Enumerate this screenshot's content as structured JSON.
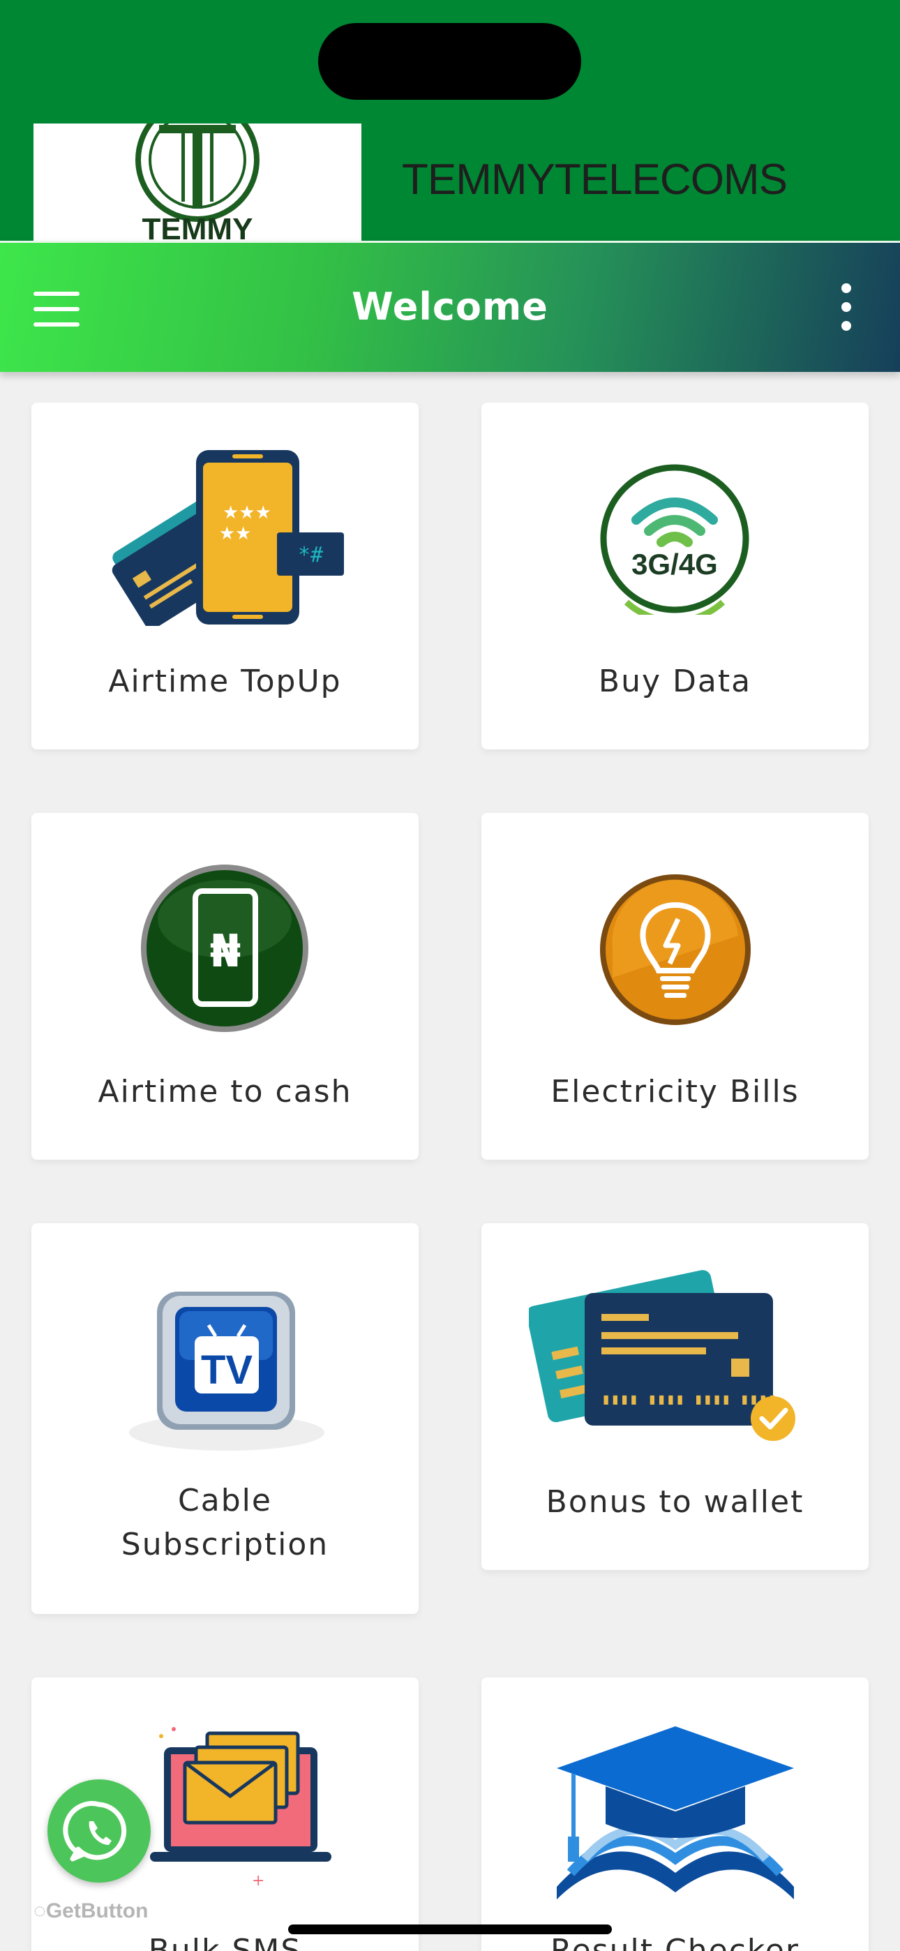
{
  "header": {
    "logo_text": "TEMMY",
    "brand": "TEMMYTELECOMS"
  },
  "app_bar": {
    "title": "Welcome"
  },
  "tiles": [
    {
      "label": "Airtime TopUp",
      "icon": "airtime-topup-icon"
    },
    {
      "label": "Buy Data",
      "icon": "buy-data-icon",
      "icon_text": "3G/4G"
    },
    {
      "label": "Airtime to cash",
      "icon": "airtime-to-cash-icon",
      "icon_text": "₦"
    },
    {
      "label": "Electricity Bills",
      "icon": "electricity-bulb-icon"
    },
    {
      "label_line1": "Cable",
      "label_line2": "Subscription",
      "icon": "tv-icon",
      "icon_text": "TV"
    },
    {
      "label": "Bonus to wallet",
      "icon": "bonus-card-icon"
    },
    {
      "label": "Bulk SMS",
      "icon": "bulk-sms-icon"
    },
    {
      "label": "Result Checker",
      "icon": "graduation-cap-icon"
    }
  ],
  "floating": {
    "whatsapp_icon": "whatsapp-icon",
    "getbutton_label": "GetButton"
  },
  "colors": {
    "header_green": "#008733",
    "appbar_start": "#3ee64a",
    "appbar_end": "#163f5a"
  }
}
